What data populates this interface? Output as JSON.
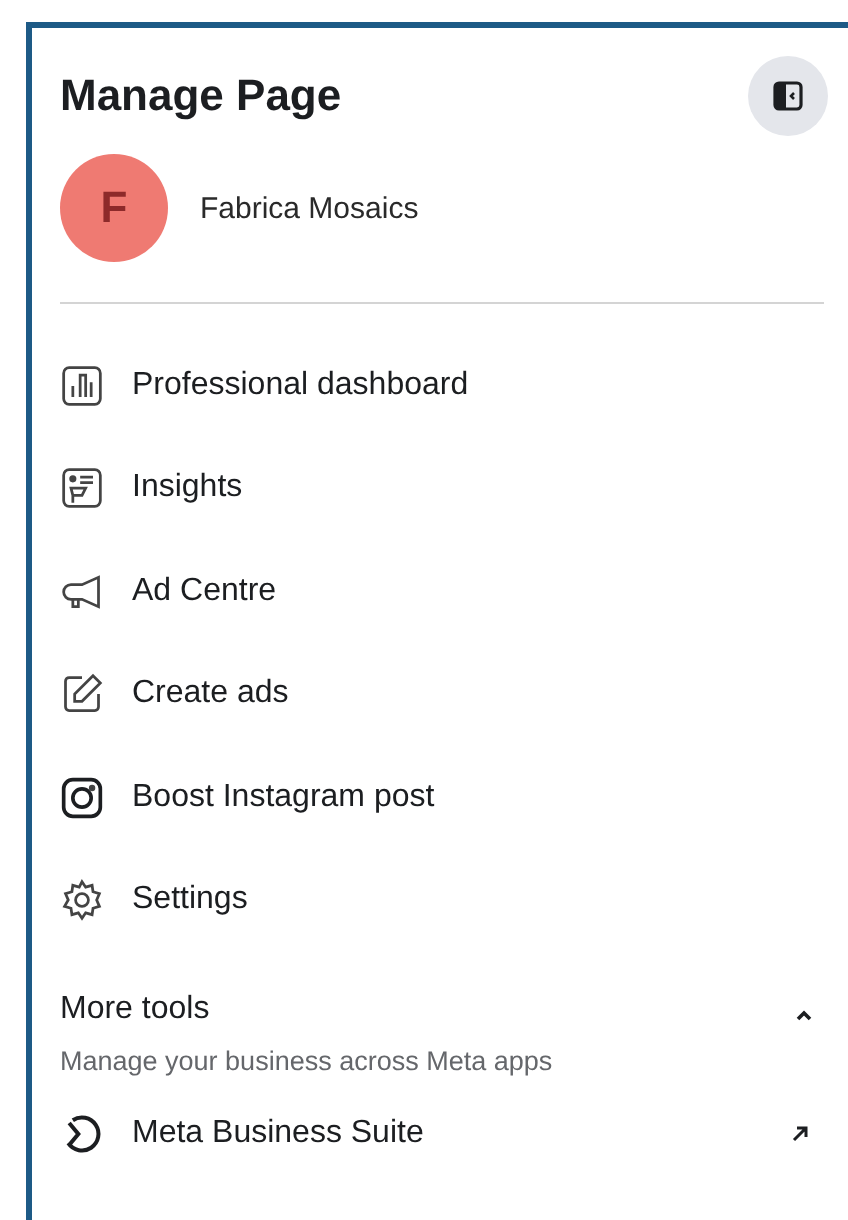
{
  "header": {
    "title": "Manage Page"
  },
  "page": {
    "name": "Fabrica Mosaics",
    "initial": "F"
  },
  "menu": [
    {
      "label": "Professional dashboard",
      "kind": "dashboard"
    },
    {
      "label": "Insights",
      "kind": "insights"
    },
    {
      "label": "Ad Centre",
      "kind": "megaphone"
    },
    {
      "label": "Create ads",
      "kind": "edit"
    },
    {
      "label": "Boost Instagram post",
      "kind": "instagram"
    },
    {
      "label": "Settings",
      "kind": "settings"
    }
  ],
  "more_tools": {
    "title": "More tools",
    "subtitle": "Manage your business across Meta apps",
    "expanded": true,
    "items": [
      {
        "label": "Meta Business Suite",
        "kind": "suite"
      }
    ]
  }
}
